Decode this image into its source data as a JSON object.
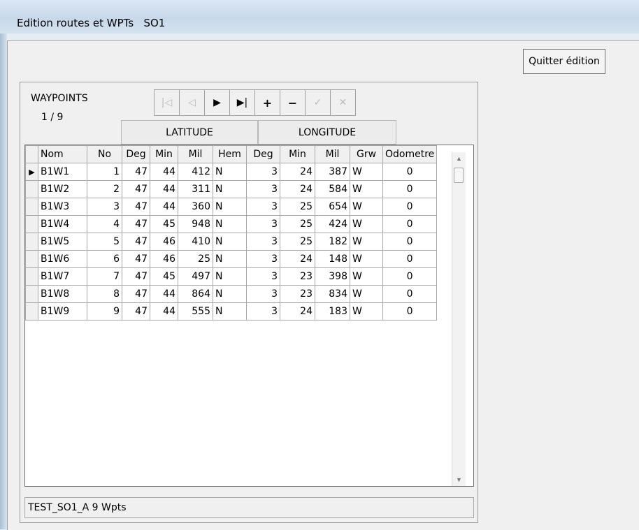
{
  "window": {
    "title": "Edition routes et WPTs",
    "route": "SO1"
  },
  "quit_button": "Quitter édition",
  "waypoints_label": "WAYPOINTS",
  "position": "1 / 9",
  "nav": {
    "first": "|◁",
    "prev": "◁",
    "next": "▶",
    "last": "▶|",
    "insert": "+",
    "delete": "−",
    "post": "✓",
    "cancel": "✕"
  },
  "groups": {
    "latitude": "LATITUDE",
    "longitude": "LONGITUDE"
  },
  "columns": [
    "Nom",
    "No",
    "Deg",
    "Min",
    "Mil",
    "Hem",
    "Deg",
    "Min",
    "Mil",
    "Grw",
    "Odometre"
  ],
  "rows": [
    [
      "B1W1",
      "1",
      "47",
      "44",
      "412",
      "N",
      "3",
      "24",
      "387",
      "W",
      "0"
    ],
    [
      "B1W2",
      "2",
      "47",
      "44",
      "311",
      "N",
      "3",
      "24",
      "584",
      "W",
      "0"
    ],
    [
      "B1W3",
      "3",
      "47",
      "44",
      "360",
      "N",
      "3",
      "25",
      "654",
      "W",
      "0"
    ],
    [
      "B1W4",
      "4",
      "47",
      "45",
      "948",
      "N",
      "3",
      "25",
      "424",
      "W",
      "0"
    ],
    [
      "B1W5",
      "5",
      "47",
      "46",
      "410",
      "N",
      "3",
      "25",
      "182",
      "W",
      "0"
    ],
    [
      "B1W6",
      "6",
      "47",
      "46",
      "25",
      "N",
      "3",
      "24",
      "148",
      "W",
      "0"
    ],
    [
      "B1W7",
      "7",
      "47",
      "45",
      "497",
      "N",
      "3",
      "23",
      "398",
      "W",
      "0"
    ],
    [
      "B1W8",
      "8",
      "47",
      "44",
      "864",
      "N",
      "3",
      "23",
      "834",
      "W",
      "0"
    ],
    [
      "B1W9",
      "9",
      "47",
      "44",
      "555",
      "N",
      "3",
      "24",
      "183",
      "W",
      "0"
    ]
  ],
  "current_row_indicator": "▶",
  "status": "TEST_SO1_A  9 Wpts"
}
